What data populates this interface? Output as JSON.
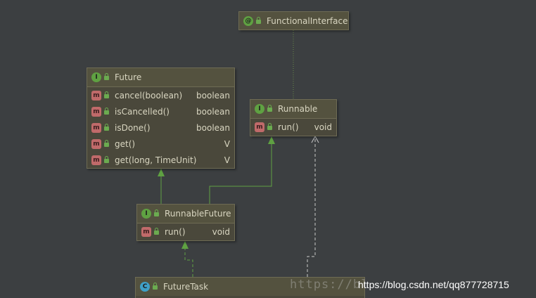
{
  "nodes": {
    "functional_interface": {
      "badge": "@",
      "title": "FunctionalInterface"
    },
    "future": {
      "badge": "I",
      "title": "Future",
      "members": [
        {
          "badge": "m",
          "name": "cancel(boolean)",
          "type": "boolean"
        },
        {
          "badge": "m",
          "name": "isCancelled()",
          "type": "boolean"
        },
        {
          "badge": "m",
          "name": "isDone()",
          "type": "boolean"
        },
        {
          "badge": "m",
          "name": "get()",
          "type": "V"
        },
        {
          "badge": "m",
          "name": "get(long, TimeUnit)",
          "type": "V"
        }
      ]
    },
    "runnable": {
      "badge": "I",
      "title": "Runnable",
      "members": [
        {
          "badge": "m",
          "name": "run()",
          "type": "void"
        }
      ]
    },
    "runnable_future": {
      "badge": "I",
      "title": "RunnableFuture",
      "members": [
        {
          "badge": "m",
          "name": "run()",
          "type": "void"
        }
      ]
    },
    "future_task": {
      "badge": "C",
      "title": "FutureTask"
    }
  },
  "watermark": {
    "faint": "https://bl",
    "front": "https://blog.csdn.net/qq877728715"
  },
  "colors": {
    "background": "#3c3f41",
    "node_fill": "#4a483b",
    "extends_edge": "#5fa142",
    "implements_edge": "#c8c8c8",
    "annotation_edge": "#6a8a4a"
  },
  "icons": {
    "interface": "interface-badge-icon",
    "class": "class-badge-icon",
    "annotation": "annotation-badge-icon",
    "method": "method-badge-icon",
    "visibility": "public-lock-icon"
  }
}
